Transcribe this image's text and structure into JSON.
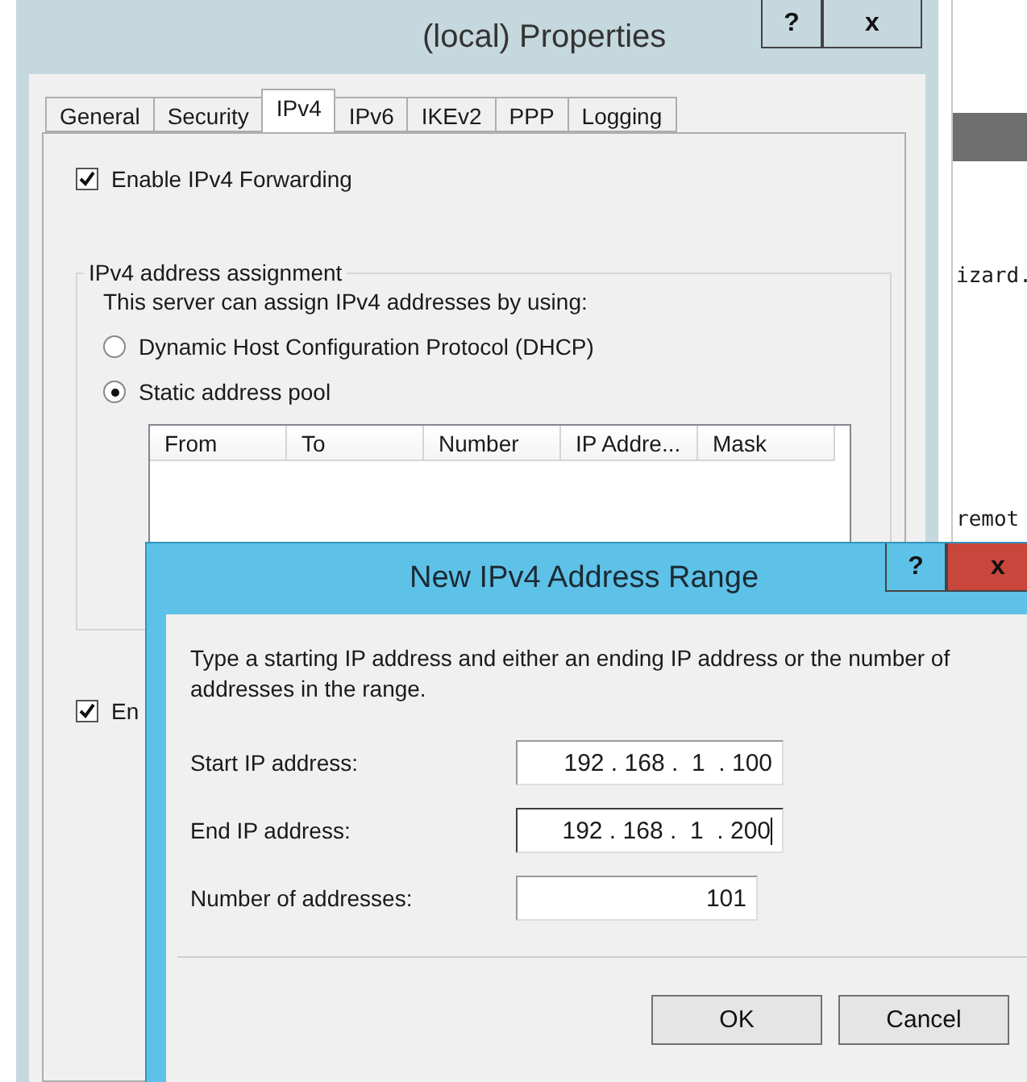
{
  "main_window": {
    "title": "(local) Properties",
    "buttons": [
      "?",
      "x"
    ]
  },
  "tabs": [
    {
      "label": "General",
      "selected": false
    },
    {
      "label": "Security",
      "selected": false
    },
    {
      "label": "IPv4",
      "selected": true
    },
    {
      "label": "IPv6",
      "selected": false
    },
    {
      "label": "IKEv2",
      "selected": false
    },
    {
      "label": "PPP",
      "selected": false
    },
    {
      "label": "Logging",
      "selected": false
    }
  ],
  "forwarding": {
    "label": "Enable IPv4 Forwarding",
    "checked": true
  },
  "assignment_group": {
    "title": "IPv4 address assignment",
    "description": "This server can assign IPv4 addresses by using:",
    "options": [
      {
        "label": "Dynamic Host Configuration Protocol (DHCP)",
        "selected": false
      },
      {
        "label": "Static address pool",
        "selected": true
      }
    ],
    "columns": [
      "From",
      "To",
      "Number",
      "IP Addre...",
      "Mask"
    ]
  },
  "second_checkbox": {
    "label": "En",
    "checked": true
  },
  "background_window": {
    "texts": [
      "izard.",
      "remot"
    ]
  },
  "dialog": {
    "title": "New IPv4 Address Range",
    "buttons": [
      {
        "label": "?",
        "kind": "help"
      },
      {
        "label": "x",
        "kind": "close"
      }
    ],
    "instructions": "Type a starting IP address and either an ending IP address or the number of addresses in the range.",
    "fields": [
      {
        "label": "Start IP address:",
        "value": "192 . 168 .  1  . 100",
        "kind": "ip",
        "focused": false
      },
      {
        "label": "End IP address:",
        "value": "192 . 168 .  1  . 200",
        "kind": "ip",
        "focused": true
      },
      {
        "label": "Number of addresses:",
        "value": "101",
        "kind": "number",
        "focused": false
      }
    ],
    "actions": [
      "OK",
      "Cancel"
    ]
  }
}
